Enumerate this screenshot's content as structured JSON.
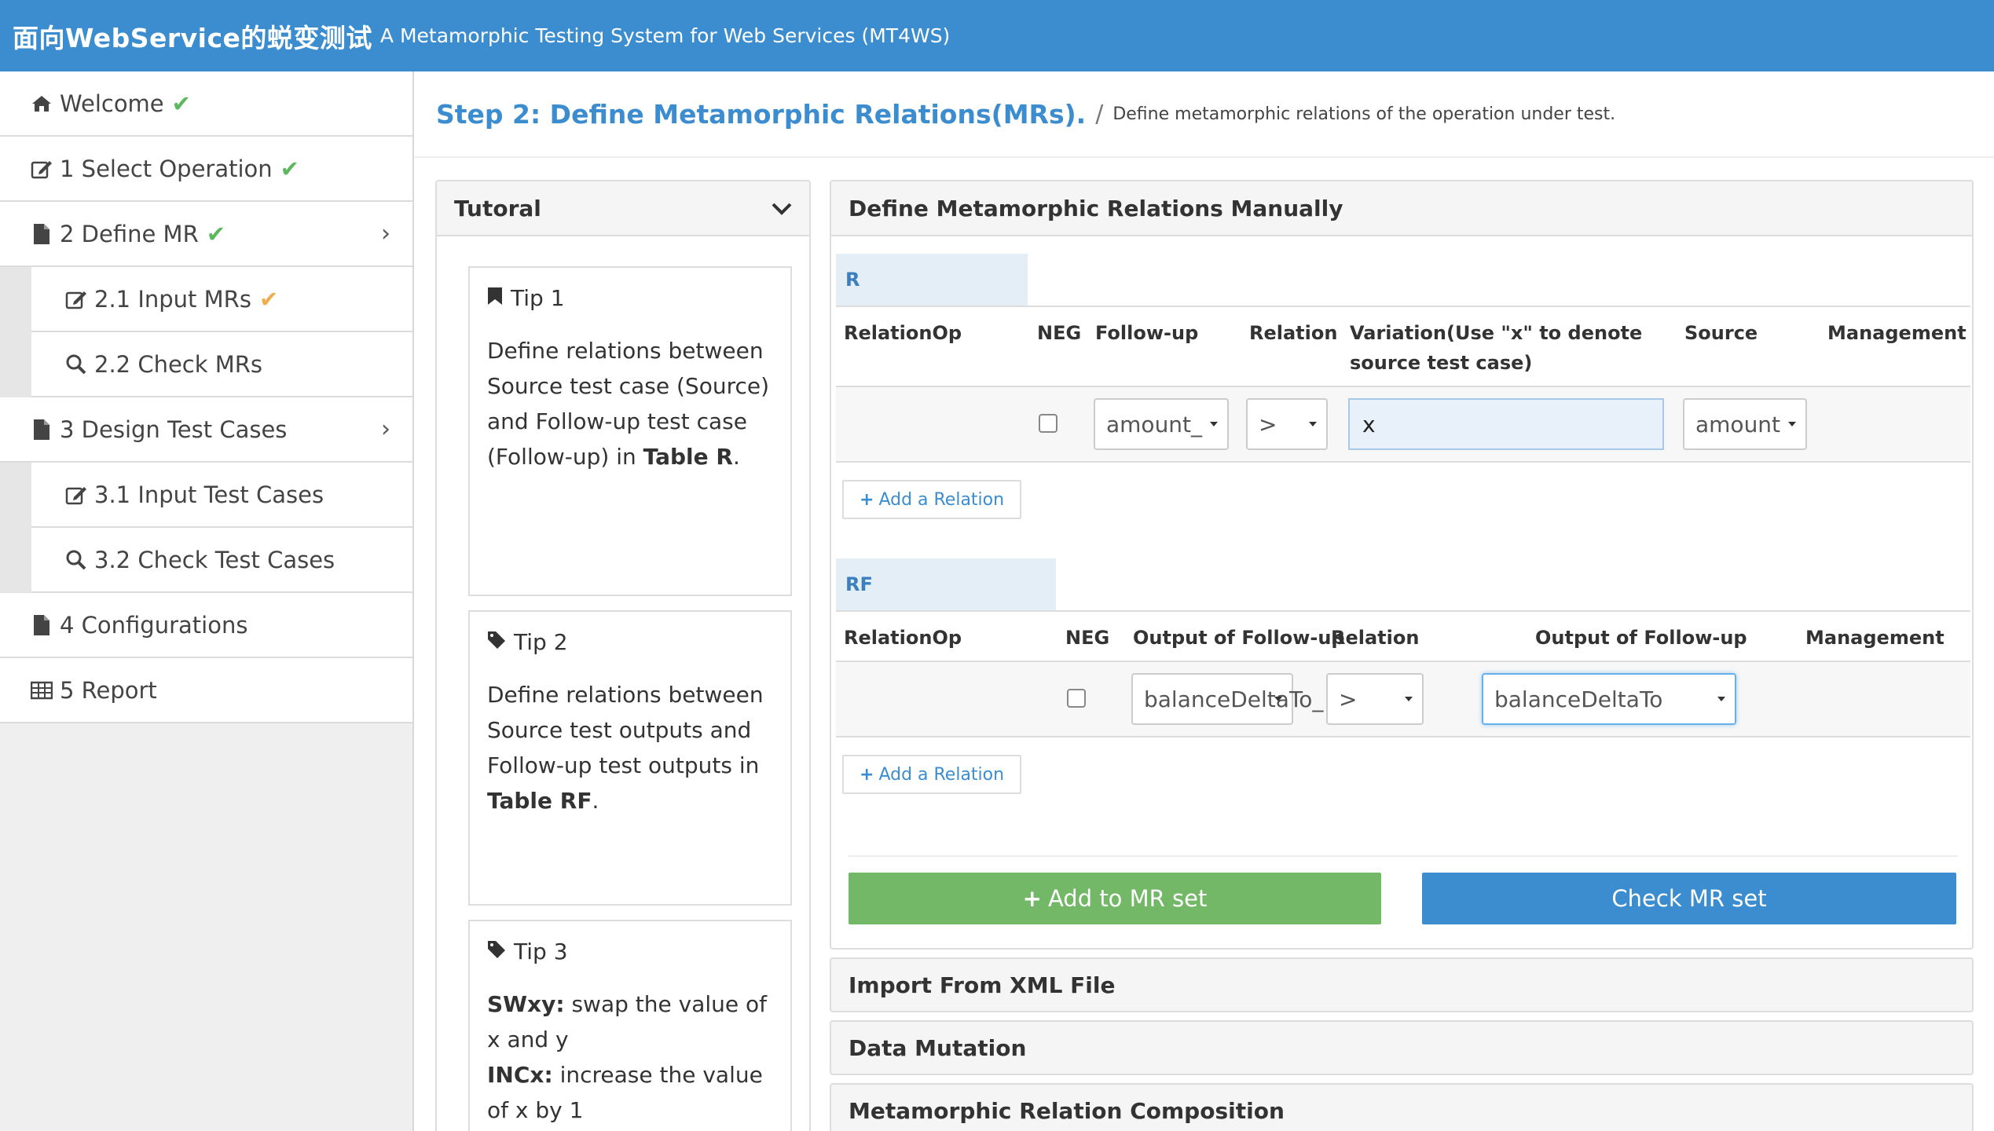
{
  "header": {
    "brand_cn": "面向WebService的蜕变测试",
    "brand_en": "A Metamorphic Testing System for Web Services (MT4WS)"
  },
  "sidebar": {
    "items": [
      {
        "label": "Welcome",
        "icon": "home-icon",
        "status": "done"
      },
      {
        "label": "1 Select Operation",
        "icon": "edit-icon",
        "status": "done"
      },
      {
        "label": "2 Define MR",
        "icon": "file-icon",
        "status": "done",
        "expandable": true
      },
      {
        "label": "2.1 Input MRs",
        "icon": "edit-icon",
        "status": "warn",
        "sub": true
      },
      {
        "label": "2.2 Check MRs",
        "icon": "search-icon",
        "sub": true
      },
      {
        "label": "3 Design Test Cases",
        "icon": "file-icon",
        "expandable": true
      },
      {
        "label": "3.1 Input Test Cases",
        "icon": "edit-icon",
        "sub": true
      },
      {
        "label": "3.2 Check Test Cases",
        "icon": "search-icon",
        "sub": true
      },
      {
        "label": "4 Configurations",
        "icon": "file-icon"
      },
      {
        "label": "5 Report",
        "icon": "table-icon"
      }
    ]
  },
  "page": {
    "step_title": "Step 2: Define Metamorphic Relations(MRs).",
    "separator": "/",
    "description": "Define metamorphic relations of the operation under test."
  },
  "tutorial": {
    "title": "Tutoral",
    "tips": [
      {
        "title": "Tip 1",
        "icon": "bookmark-icon",
        "body_pre": "Define relations between Source test case (Source) and Follow-up test case (Follow-up) in ",
        "body_bold": "Table R",
        "body_post": "."
      },
      {
        "title": "Tip 2",
        "icon": "tag-icon",
        "body_pre": "Define relations between Source test outputs and Follow-up test outputs in ",
        "body_bold": "Table RF",
        "body_post": "."
      },
      {
        "title": "Tip 3",
        "icon": "tag-icon",
        "swxy_key": "SWxy:",
        "swxy_text": " swap the value of x and y",
        "incx_key": "INCx:",
        "incx_text": " increase the value of x by 1"
      }
    ]
  },
  "define_panel": {
    "title": "Define Metamorphic Relations Manually",
    "r_table": {
      "label": "R",
      "headers": {
        "relation_op": "RelationOp",
        "neg": "NEG",
        "follow_up": "Follow-up",
        "relation": "Relation",
        "variation_line1": "Variation(Use \"x\" to denote",
        "variation_line2": "source test case)",
        "source": "Source",
        "management": "Management"
      },
      "row": {
        "follow_up": "amount_",
        "relation": ">",
        "variation": "x",
        "source": "amount"
      },
      "add_label": "Add a Relation"
    },
    "rf_table": {
      "label": "RF",
      "headers": {
        "relation_op": "RelationOp",
        "neg": "NEG",
        "output_follow_up_1": "Output of Follow-up",
        "relation": "Relation",
        "output_follow_up_2": "Output of Follow-up",
        "management": "Management"
      },
      "row": {
        "output1": "balanceDeltaTo_",
        "relation": ">",
        "output2": "balanceDeltaTo"
      },
      "add_label": "Add a Relation"
    },
    "add_mr_label": "Add to MR set",
    "check_mr_label": "Check MR set"
  },
  "collapsed_panels": [
    "Import From XML File",
    "Data Mutation",
    "Metamorphic Relation Composition"
  ],
  "colors": {
    "primary": "#3b8dcf",
    "success": "#5cb85c",
    "warning": "#f0ad4e",
    "green_button": "#72b866"
  }
}
